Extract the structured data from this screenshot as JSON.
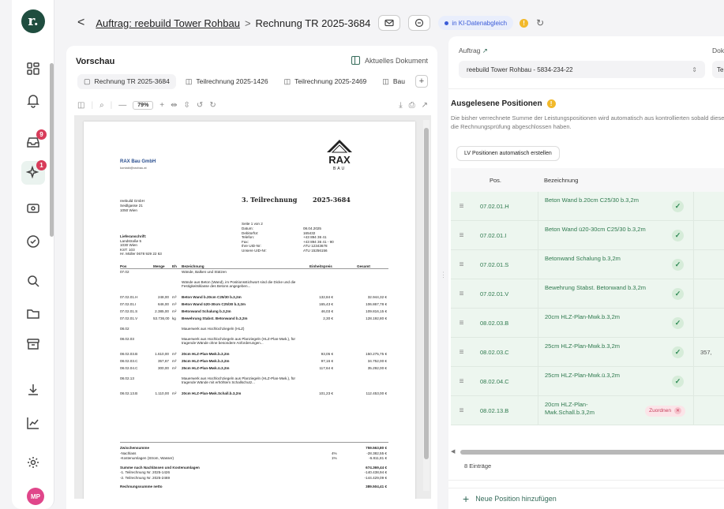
{
  "sidebar": {
    "logo": "r.",
    "items": [
      {
        "name": "dashboard-icon"
      },
      {
        "name": "bell-icon"
      },
      {
        "name": "inbox-icon",
        "badge": "9"
      },
      {
        "name": "sparkle-icon",
        "badge": "1"
      },
      {
        "name": "document-scan-icon"
      },
      {
        "name": "check-circle-icon"
      },
      {
        "name": "search-icon"
      },
      {
        "name": "folder-icon"
      },
      {
        "name": "archive-icon"
      },
      {
        "name": "download-icon"
      },
      {
        "name": "chart-icon"
      },
      {
        "name": "settings-icon"
      }
    ],
    "avatar": "MP"
  },
  "topbar": {
    "back": "<",
    "breadcrumb_link": "Auftrag: reebuild Tower Rohbau",
    "separator": ">",
    "current": "Rechnung TR 2025-3684",
    "status": "in KI-Datenabgleich",
    "warn": "!"
  },
  "preview": {
    "title": "Vorschau",
    "current_doc": "Aktuelles Dokument",
    "tabs": [
      "Rechnung TR 2025-3684",
      "Teilrechnung 2025-1426",
      "Teilrechnung 2025-2469",
      "Bau"
    ],
    "tab_add": "+",
    "zoom": "79%"
  },
  "pdf": {
    "company": "RAX Bau GmbH",
    "company_email": "kontakt@raxbau.at",
    "logo_text": "RAX",
    "logo_sub": "BAU",
    "recipient": [
      "reebuild GmbH",
      "Seidlgasse 21",
      "1050 Wien"
    ],
    "doc_title": "3. Teilrechnung",
    "doc_number": "2025-3684",
    "page_info": "Seite 1 von 2",
    "meta_labels": [
      "Datum:",
      "Debitorfür:",
      "Telefon:",
      "Fax:",
      "Ihre UID-Nr:",
      "Unsere UID-Nr:"
    ],
    "meta_values": [
      "08.04.2025",
      "165432",
      "+43 894 36 41",
      "+43 894 36 41 - 90",
      "ATU 12343678",
      "ATU 15256156"
    ],
    "delivery": [
      "Lieferanschrift:",
      "Landstraße 5",
      "1030 Wien",
      "KST: 103",
      "Hr. Müller 0678 929 22 63"
    ],
    "cols": [
      "Pos",
      "Menge",
      "Eh",
      "Bezeichnung",
      "Einheitspreis",
      "Gesamt"
    ],
    "lines": [
      [
        "07.02",
        "",
        "",
        "Wände, Balken und Stützen",
        "",
        ""
      ],
      [
        "",
        "",
        "",
        "Wände aus Beton (Wand), im Positionsstichwort sind die Dicke und die Festigkeitsklasse des Betons angegeben...",
        "",
        ""
      ],
      [
        "07.02.01.H",
        "248,00",
        "m³",
        "Beton Wand b.20cm C25/30 b.3,2m",
        "132,84 €",
        "32.944,32 €"
      ],
      [
        "07.02.01.I",
        "646,00",
        "m³",
        "Beton Wand ü20-30cm C25/30 b.3,2m",
        "165,43 €",
        "106.867,78 €"
      ],
      [
        "07.02.01.S",
        "2.385,00",
        "m²",
        "Betonwand Schalung b.3,2m",
        "46,03 €",
        "109.816,15 €"
      ],
      [
        "07.02.01.V",
        "53.736,00",
        "kg",
        "Bewehrung Stabst. Betonwand b.3,2m",
        "2,30 €",
        "128.192,80 €"
      ],
      [
        "08.02",
        "",
        "",
        "Mauerwerk aus Hochlochziegeln (HLZ)",
        "",
        ""
      ],
      [
        "08.02.03",
        "",
        "",
        "Mauerwerk aus Hochlochziegeln aus Planziegeln (HLZ-Plan-Mwk.), für tragende Wände ohne besondere Anforderungen...",
        "",
        ""
      ],
      [
        "08.02.03.B",
        "1.610,00",
        "m²",
        "20cm HLZ-Plan-Mwk.b.3,2m",
        "93,05 €",
        "150.275,75 €"
      ],
      [
        "08.02.03.C",
        "357,67",
        "m²",
        "25cm HLZ-Plan-Mwk.b.3,2m",
        "97,16 €",
        "34.752,00 €"
      ],
      [
        "08.02.04.C",
        "300,00",
        "m²",
        "25cm HLZ-Plan-Mwk.ü.3,2m",
        "117,64 €",
        "35.292,00 €"
      ],
      [
        "08.02.13",
        "",
        "",
        "Mauerwerk aus Hochlochziegeln aus Planziegeln (HLZ-Plan-Mwk.), für tragende Wände mit erhöhtem Schallschutz...",
        "",
        ""
      ],
      [
        "08.02.13.B",
        "1.110,00",
        "m²",
        "20cm HLZ-Plan-Mwk.Schall.b.3,2m",
        "101,23 €",
        "112.453,00 €"
      ]
    ],
    "totals": [
      [
        "Zwischensumme",
        "",
        "759.563,80 €"
      ],
      [
        "-Nachlass",
        "4%",
        "-28.382,55 €"
      ],
      [
        "-Kostenumlagen (Strom, Wasser)",
        "1%",
        "-6.811,81 €"
      ],
      [
        "Summe nach Nachlässen und Kostenumlagen",
        "",
        "674.369,44 €"
      ],
      [
        "-1. Teilrechnung Nr. 2025-1426",
        "",
        "-140.438,94 €"
      ],
      [
        "-2. Teilrechnung Nr. 2025-2469",
        "",
        "-144.429,09 €"
      ],
      [
        "Rechnungssumme netto",
        "",
        "389.504,41 €"
      ]
    ]
  },
  "right": {
    "auftrag_label": "Auftrag",
    "auftrag_value": "reebuild Tower Rohbau - 5834-234-22",
    "dok_label": "Dok",
    "dok_value": "Te",
    "heading": "Ausgelesene Positionen",
    "description": "Die bisher verrechnete Summe der Leistungspositionen wird automatisch aus kontrollierten sobald diese die Rechnungsprüfung abgeschlossen haben.",
    "lv_button": "LV Positionen automatisch erstellen",
    "col_pos": "Pos.",
    "col_bez": "Bezeichnung",
    "rows": [
      {
        "pos": "07.02.01.H",
        "bez": "Beton Wand b.20cm C25/30 b.3,2m",
        "extra": ""
      },
      {
        "pos": "07.02.01.I",
        "bez": "Beton Wand ü20-30cm C25/30 b.3,2m",
        "extra": ""
      },
      {
        "pos": "07.02.01.S",
        "bez": "Betonwand Schalung b.3,2m",
        "extra": ""
      },
      {
        "pos": "07.02.01.V",
        "bez": "Bewehrung Stabst. Betonwand b.3,2m",
        "extra": ""
      },
      {
        "pos": "08.02.03.B",
        "bez": "20cm HLZ-Plan-Mwk.b.3,2m",
        "extra": ""
      },
      {
        "pos": "08.02.03.C",
        "bez": "25cm HLZ-Plan-Mwk.b.3,2m",
        "extra": "357,"
      },
      {
        "pos": "08.02.04.C",
        "bez": "25cm HLZ-Plan-Mwk.ü.3,2m",
        "extra": ""
      },
      {
        "pos": "08.02.13.B",
        "bez": "20cm HLZ-Plan-Mwk.Schall.b.3,2m",
        "extra": "",
        "tag": "Zuordnen"
      }
    ],
    "count": "8 Einträge",
    "new_position": "Neue Position hinzufügen"
  }
}
